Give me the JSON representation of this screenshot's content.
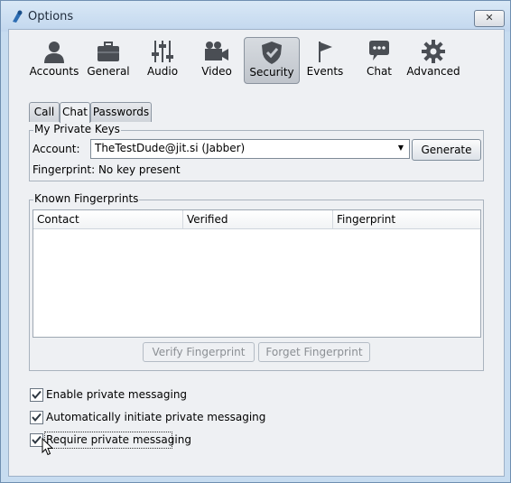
{
  "window": {
    "title": "Options",
    "close_label": "✕"
  },
  "toolbar": {
    "items": [
      {
        "label": "Accounts",
        "icon": "accounts-icon"
      },
      {
        "label": "General",
        "icon": "briefcase-icon"
      },
      {
        "label": "Audio",
        "icon": "mixer-icon"
      },
      {
        "label": "Video",
        "icon": "camera-icon"
      },
      {
        "label": "Security",
        "icon": "shield-icon",
        "selected": true
      },
      {
        "label": "Events",
        "icon": "flag-icon"
      },
      {
        "label": "Chat",
        "icon": "chat-icon"
      },
      {
        "label": "Advanced",
        "icon": "gear-icon"
      }
    ]
  },
  "tabs": [
    {
      "label": "Call"
    },
    {
      "label": "Chat",
      "active": true
    },
    {
      "label": "Passwords"
    }
  ],
  "private_keys": {
    "title": "My Private Keys",
    "account_label": "Account:",
    "account_value": "TheTestDude@jit.si (Jabber)",
    "generate_label": "Generate",
    "fingerprint_text": "Fingerprint: No key present"
  },
  "known_fingerprints": {
    "title": "Known Fingerprints",
    "columns": [
      "Contact",
      "Verified",
      "Fingerprint"
    ],
    "rows": [],
    "verify_label": "Verify Fingerprint",
    "forget_label": "Forget Fingerprint"
  },
  "options": [
    {
      "label": "Enable private messaging",
      "checked": true
    },
    {
      "label": "Automatically initiate private messaging",
      "checked": true
    },
    {
      "label": "Require private messaging",
      "checked": true,
      "focused": true
    }
  ]
}
